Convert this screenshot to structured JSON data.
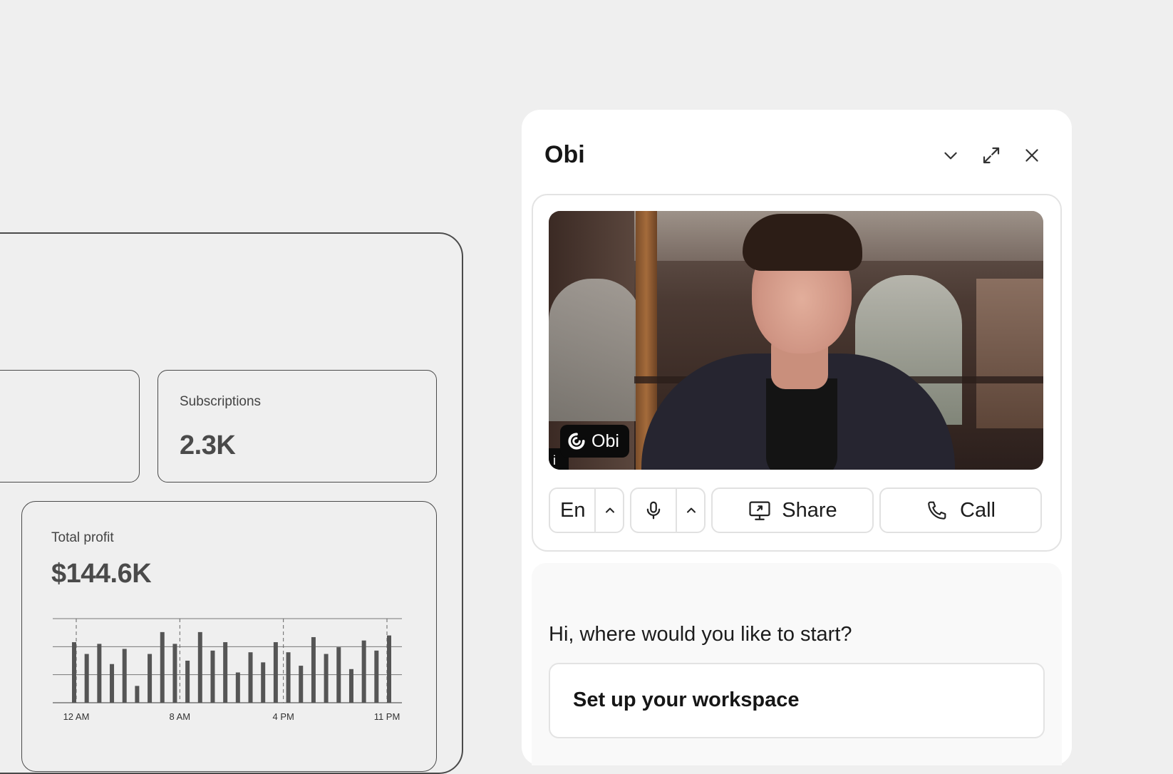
{
  "dashboard": {
    "subscriptions": {
      "label": "Subscriptions",
      "value": "2.3K"
    },
    "total_profit": {
      "label": "Total profit",
      "value": "$144.6K"
    }
  },
  "chart_data": {
    "type": "bar",
    "x_tick_labels": [
      "12 AM",
      "8 AM",
      "4 PM",
      "11 PM"
    ],
    "values": [
      3.6,
      2.9,
      3.5,
      2.3,
      3.2,
      1.0,
      2.9,
      4.2,
      3.5,
      2.5,
      4.2,
      3.1,
      3.6,
      1.8,
      3.0,
      2.4,
      3.6,
      3.0,
      2.2,
      3.9,
      2.9,
      3.3,
      2.0,
      3.7,
      3.1,
      4.0
    ],
    "ylim": [
      0,
      5
    ],
    "grid": true,
    "xlabel": "",
    "ylabel": ""
  },
  "panel": {
    "title": "Obi",
    "header_icons": [
      "chevron-down-icon",
      "expand-icon",
      "close-icon"
    ],
    "video": {
      "badge_label": "Obi",
      "badge_sub": "i"
    },
    "controls": {
      "language": "En",
      "share_label": "Share",
      "call_label": "Call"
    },
    "greeting": "Hi, where would you like to start?",
    "suggestions": [
      "Set up your workspace"
    ]
  },
  "colors": {
    "background": "#efefef",
    "panel": "#ffffff",
    "chart_bar": "#555555",
    "border": "#e1e1e1"
  }
}
